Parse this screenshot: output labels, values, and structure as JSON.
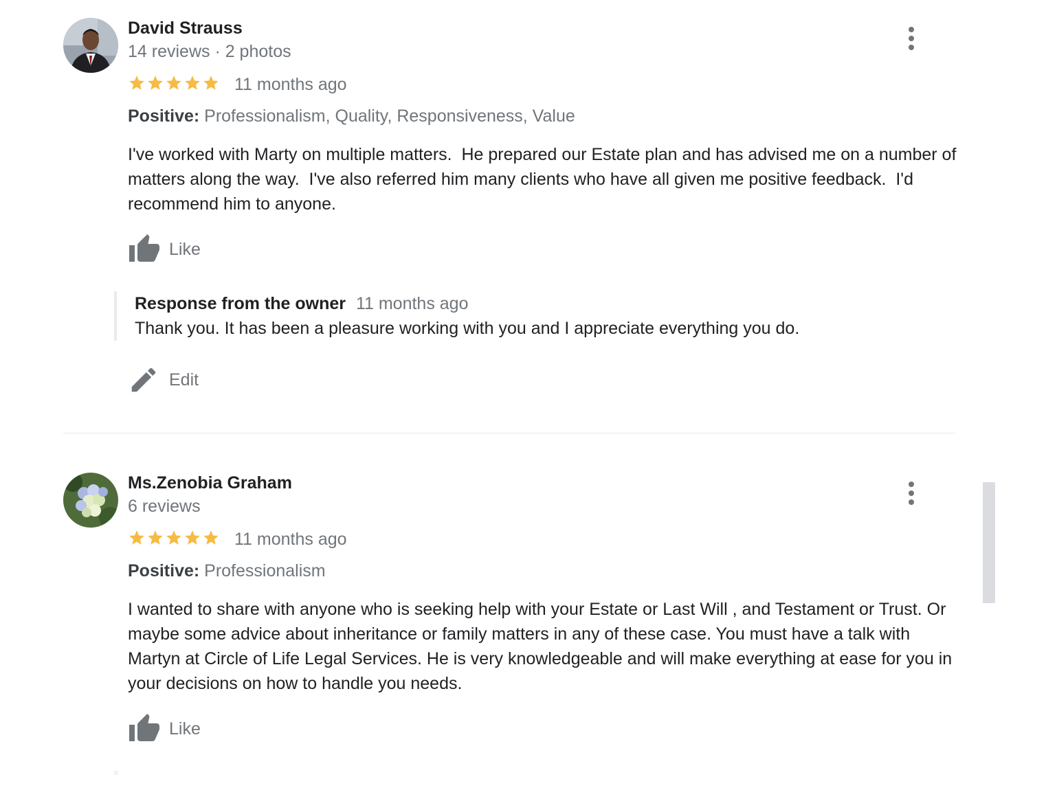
{
  "colors": {
    "star": "#f6bb42",
    "secondary_text": "#70757a",
    "primary_text": "#202124",
    "divider": "#e8eaed",
    "scrollbar": "#dadce0"
  },
  "reviews": [
    {
      "author": "David Strauss",
      "stats": "14 reviews · 2 photos",
      "rating": 5,
      "rating_max": 5,
      "time": "11 months ago",
      "positive_label": "Positive:",
      "positive_values": "Professionalism, Quality, Responsiveness, Value",
      "text": "I've worked with Marty on multiple matters.  He prepared our Estate plan and has advised me on a number of matters along the way.  I've also referred him many clients who have all given me positive feedback.  I'd recommend him to anyone.",
      "like_label": "Like",
      "menu_icon": "more-vert-icon",
      "response": {
        "heading": "Response from the owner",
        "time": "11 months ago",
        "text": "Thank you. It has been a pleasure working with you and I appreciate everything you do.",
        "edit_label": "Edit"
      }
    },
    {
      "author": "Ms.Zenobia Graham",
      "stats": "6 reviews",
      "rating": 5,
      "rating_max": 5,
      "time": "11 months ago",
      "positive_label": "Positive:",
      "positive_values": "Professionalism",
      "text": "I wanted to share with anyone who is seeking help with your Estate or Last Will , and Testament or Trust. Or maybe some advice about inheritance or family matters in any of these case. You must have a talk with Martyn at Circle of Life Legal Services. He is very knowledgeable and will make everything at ease for you in your decisions on how to handle you needs.",
      "like_label": "Like",
      "menu_icon": "more-vert-icon"
    }
  ]
}
